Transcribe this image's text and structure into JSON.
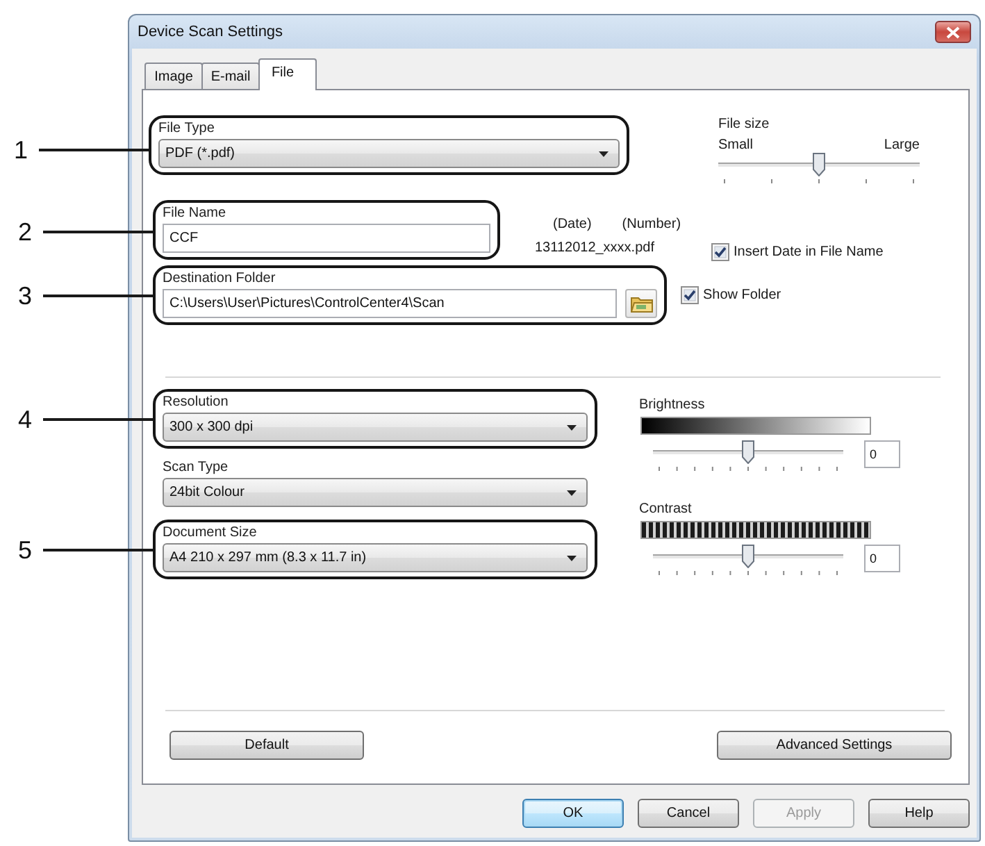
{
  "window": {
    "title": "Device Scan Settings"
  },
  "tabs": [
    {
      "label": "Image",
      "selected": false
    },
    {
      "label": "E-mail",
      "selected": false
    },
    {
      "label": "File",
      "selected": true
    }
  ],
  "file_type": {
    "label": "File Type",
    "value": "PDF (*.pdf)",
    "callout": "1"
  },
  "file_size": {
    "label": "File size",
    "min_label": "Small",
    "max_label": "Large",
    "level": 0.5
  },
  "file_name": {
    "label": "File Name",
    "value": "CCF",
    "callout": "2"
  },
  "file_name_example": {
    "date_label": "(Date)",
    "number_label": "(Number)",
    "example": "13112012_xxxx.pdf"
  },
  "insert_date": {
    "label": "Insert Date in File Name",
    "checked": true
  },
  "destination_folder": {
    "label": "Destination Folder",
    "value": "C:\\Users\\User\\Pictures\\ControlCenter4\\Scan",
    "callout": "3"
  },
  "show_folder": {
    "label": "Show Folder",
    "checked": true
  },
  "resolution": {
    "label": "Resolution",
    "value": "300 x 300 dpi",
    "callout": "4"
  },
  "scan_type": {
    "label": "Scan Type",
    "value": "24bit Colour"
  },
  "document_size": {
    "label": "Document Size",
    "value": "A4 210 x 297 mm (8.3 x 11.7 in)",
    "callout": "5"
  },
  "brightness": {
    "label": "Brightness",
    "level": 0.5,
    "value": "0"
  },
  "contrast": {
    "label": "Contrast",
    "level": 0.5,
    "value": "0"
  },
  "panel_buttons": [
    {
      "label": "Default"
    },
    {
      "label": "Advanced Settings"
    }
  ],
  "buttons": [
    {
      "label": "OK",
      "default": true,
      "disabled": false
    },
    {
      "label": "Cancel",
      "default": false,
      "disabled": false
    },
    {
      "label": "Apply",
      "default": false,
      "disabled": true
    },
    {
      "label": "Help",
      "default": false,
      "disabled": false
    }
  ]
}
